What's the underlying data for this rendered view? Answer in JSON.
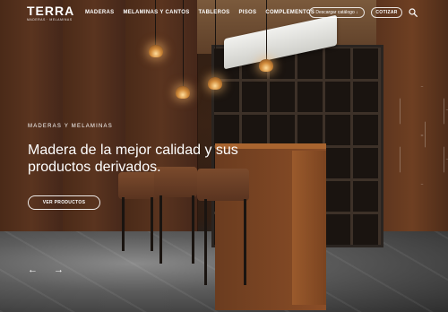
{
  "header": {
    "logo": {
      "name": "TERRA",
      "tagline": "MADERAS · MELAMINAS"
    },
    "nav": [
      "MADERAS",
      "MELAMINAS Y CANTOS",
      "TABLEROS",
      "PISOS",
      "COMPLEMENTOS"
    ],
    "catalog_button": "Descargar catálogo ↓",
    "quote_button": "COTIZAR",
    "search_icon": "search-icon"
  },
  "hero": {
    "eyebrow": "MADERAS Y MELAMINAS",
    "title": "Madera de la mejor calidad y sus productos derivados.",
    "cta": "VER PRODUCTOS",
    "prev_arrow": "←",
    "next_arrow": "→"
  }
}
